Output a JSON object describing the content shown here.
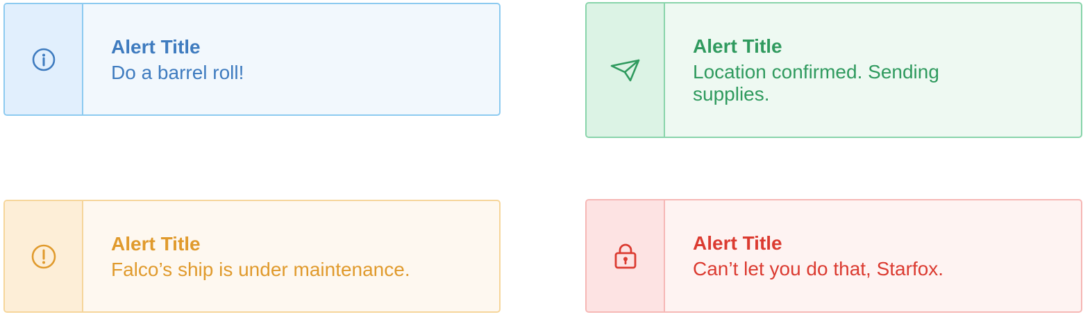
{
  "alerts": {
    "info": {
      "title": "Alert Title",
      "message": "Do a barrel roll!",
      "icon": "info-circle-icon",
      "color": "#3e7bbf"
    },
    "success": {
      "title": "Alert Title",
      "message": "Location confirmed. Sending supplies.",
      "icon": "paper-plane-icon",
      "color": "#2f9a5e"
    },
    "warning": {
      "title": "Alert Title",
      "message": "Falco’s ship is under maintenance.",
      "icon": "exclamation-circle-icon",
      "color": "#e09a2c"
    },
    "danger": {
      "title": "Alert Title",
      "message": "Can’t let you do that, Starfox.",
      "icon": "lock-icon",
      "color": "#db3a30"
    }
  }
}
